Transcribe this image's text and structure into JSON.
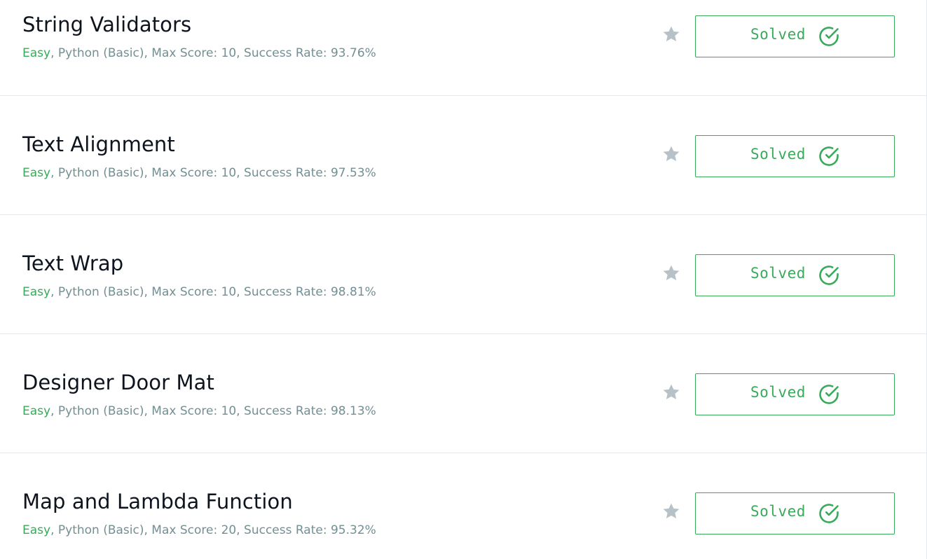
{
  "challenges": [
    {
      "title": "String Validators",
      "difficulty": "Easy",
      "details": ", Python (Basic), Max Score: 10, Success Rate: 93.76%",
      "status": "Solved"
    },
    {
      "title": "Text Alignment",
      "difficulty": "Easy",
      "details": ", Python (Basic), Max Score: 10, Success Rate: 97.53%",
      "status": "Solved"
    },
    {
      "title": "Text Wrap",
      "difficulty": "Easy",
      "details": ", Python (Basic), Max Score: 10, Success Rate: 98.81%",
      "status": "Solved"
    },
    {
      "title": "Designer Door Mat",
      "difficulty": "Easy",
      "details": ", Python (Basic), Max Score: 10, Success Rate: 98.13%",
      "status": "Solved"
    },
    {
      "title": "Map and Lambda Function",
      "difficulty": "Easy",
      "details": ", Python (Basic), Max Score: 20, Success Rate: 95.32%",
      "status": "Solved"
    }
  ],
  "icons": {
    "star": "star-icon",
    "solved": "check-circle-icon"
  },
  "colors": {
    "solved_green": "#39a95a",
    "difficulty_green": "#39a95a",
    "meta_gray": "#738f93",
    "star_gray": "#b7c2c8",
    "title_dark": "#0e141e"
  }
}
